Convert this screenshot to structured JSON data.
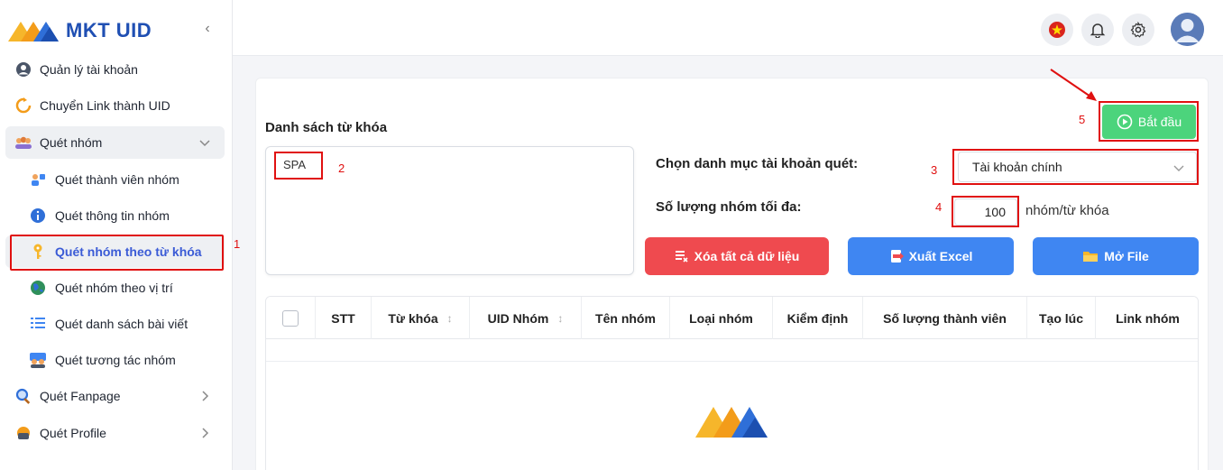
{
  "app": {
    "name": "MKT UID"
  },
  "sidebar": {
    "items": [
      {
        "label": "Quản lý tài khoản",
        "icon": "user-circle-icon"
      },
      {
        "label": "Chuyển Link thành UID",
        "icon": "refresh-icon"
      },
      {
        "label": "Quét nhóm",
        "icon": "group-icon"
      },
      {
        "label": "Quét thành viên nhóm",
        "icon": "member-icon"
      },
      {
        "label": "Quét thông tin nhóm",
        "icon": "info-icon"
      },
      {
        "label": "Quét nhóm theo từ khóa",
        "icon": "key-icon"
      },
      {
        "label": "Quét nhóm theo vị trí",
        "icon": "globe-icon"
      },
      {
        "label": "Quét danh sách bài viết",
        "icon": "list-icon"
      },
      {
        "label": "Quét tương tác nhóm",
        "icon": "people-icon"
      },
      {
        "label": "Quét Fanpage",
        "icon": "search-icon"
      },
      {
        "label": "Quét Profile",
        "icon": "profile-icon"
      }
    ]
  },
  "annotations": {
    "a1": "1",
    "a2": "2",
    "a3": "3",
    "a4": "4",
    "a5": "5"
  },
  "main": {
    "keywords_label": "Danh sách từ khóa",
    "keywords_value": "SPA",
    "account_category_label": "Chọn danh mục tài khoản quét:",
    "account_category_value": "Tài khoản chính",
    "max_groups_label": "Số lượng nhóm tối đa:",
    "max_groups_value": "100",
    "max_groups_unit": "nhóm/từ khóa",
    "start_label": "Bắt đầu",
    "clear_label": "Xóa tất cả dữ liệu",
    "export_label": "Xuất Excel",
    "open_file_label": "Mở File"
  },
  "table": {
    "columns": [
      "STT",
      "Từ khóa",
      "UID Nhóm",
      "Tên nhóm",
      "Loại nhóm",
      "Kiểm định",
      "Số lượng thành viên",
      "Tạo lúc",
      "Link nhóm"
    ]
  },
  "colors": {
    "accent": "#3b5bd6",
    "danger": "#ef4a4f",
    "primary": "#3f86f2",
    "success": "#4cd47c",
    "annotation": "#e01010"
  }
}
